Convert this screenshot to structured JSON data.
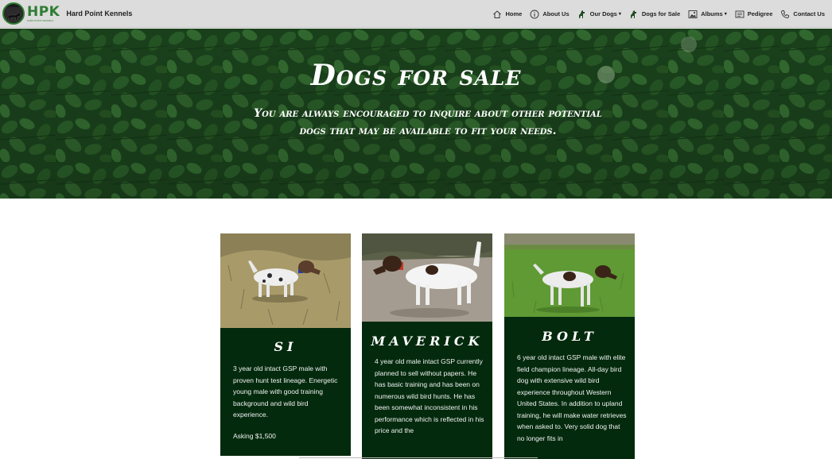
{
  "brand": {
    "logo_letters": "HPK",
    "logo_sub": "HARD POINT KENNELS",
    "site_title": "Hard Point Kennels"
  },
  "nav": {
    "items": [
      {
        "label": "Home",
        "icon": "home-icon",
        "dropdown": false
      },
      {
        "label": "About Us",
        "icon": "info-icon",
        "dropdown": false
      },
      {
        "label": "Our Dogs",
        "icon": "dog-icon",
        "dropdown": true
      },
      {
        "label": "Dogs for Sale",
        "icon": "dog-icon",
        "dropdown": false
      },
      {
        "label": "Albums",
        "icon": "image-icon",
        "dropdown": true
      },
      {
        "label": "Pedigree",
        "icon": "document-icon",
        "dropdown": false
      },
      {
        "label": "Contact Us",
        "icon": "phone-icon",
        "dropdown": false
      }
    ],
    "dropdown_caret": "▾"
  },
  "hero": {
    "title": "Dogs for sale",
    "subtitle": "You are always encouraged to inquire about other potential dogs that may be available to fit your needs."
  },
  "dogs": [
    {
      "name": "Si",
      "description": "3 year old intact GSP male with proven hunt test lineage. Energetic young male with good training background and wild bird experience.",
      "price": "Asking $1,500"
    },
    {
      "name": "Maverick",
      "description": "4 year old male intact GSP currently planned to sell without papers. He has basic training and has been on numerous wild bird hunts. He has been somewhat inconsistent in his performance which is reflected in his price and the",
      "price": ""
    },
    {
      "name": "Bolt",
      "description": "6 year old intact GSP male with elite field champion lineage. All-day bird dog with extensive wild bird experience throughout Western United States. In addition to upland training, he will make water retrieves when asked to. Very solid dog that no longer fits in",
      "price": ""
    }
  ],
  "colors": {
    "nav_bg": "#dcdcdc",
    "hero_green": "#1f4a21",
    "card_green": "#032a0d",
    "brand_green": "#2e7d32"
  }
}
